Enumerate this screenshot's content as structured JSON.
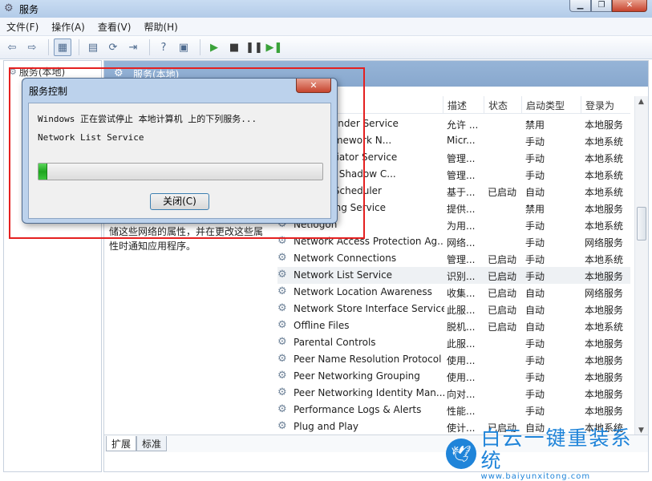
{
  "window": {
    "title": "服务",
    "min_label": "▁",
    "max_label": "❐",
    "close_label": "✕"
  },
  "menu": [
    "文件(F)",
    "操作(A)",
    "查看(V)",
    "帮助(H)"
  ],
  "toolbar": {
    "buttons": [
      "back-icon",
      "forward-icon",
      "show-tree-icon",
      "properties-icon",
      "refresh-icon",
      "export-icon",
      "help-icon",
      "console-icon",
      "play-icon",
      "stop-icon",
      "pause-icon",
      "restart-icon"
    ],
    "glyphs": {
      "back": "⇦",
      "forward": "⇨",
      "tree": "▦",
      "props": "▤",
      "refresh": "⟳",
      "export": "⇥",
      "help": "?",
      "console": "▣",
      "play": "▶",
      "stop": "■",
      "pause": "❚❚",
      "restart": "▶❚"
    }
  },
  "tree": {
    "label": "服务(本地)"
  },
  "content": {
    "header": "服务(本地)",
    "description_lines": [
      "储这些网络的属性，并在更改这些属",
      "性时通知应用程序。"
    ],
    "columns": {
      "description": "描述",
      "status": "状态",
      "startup": "启动类型",
      "logon": "登录为"
    },
    "tabs": [
      "扩展",
      "标准"
    ],
    "rows": [
      {
        "name": "nter Extender Service",
        "desc": "允许 ...",
        "status": "",
        "startup": "禁用",
        "logon": "本地服务"
      },
      {
        "name": ".NET Framework N...",
        "desc": "Micr...",
        "status": "",
        "startup": "手动",
        "logon": "本地系统"
      },
      {
        "name": "iSCSI Initiator Service",
        "desc": "管理...",
        "status": "",
        "startup": "手动",
        "logon": "本地系统"
      },
      {
        "name": "Software Shadow C...",
        "desc": "管理...",
        "status": "",
        "startup": "手动",
        "logon": "本地系统"
      },
      {
        "name": "ia Class Scheduler",
        "desc": "基于...",
        "status": "已启动",
        "startup": "自动",
        "logon": "本地系统"
      },
      {
        "name": "ort Sharing Service",
        "desc": "提供...",
        "status": "",
        "startup": "禁用",
        "logon": "本地服务"
      },
      {
        "name": "Netlogon",
        "desc": "为用...",
        "status": "",
        "startup": "手动",
        "logon": "本地系统"
      },
      {
        "name": "Network Access Protection Ag...",
        "desc": "网络...",
        "status": "",
        "startup": "手动",
        "logon": "网络服务"
      },
      {
        "name": "Network Connections",
        "desc": "管理...",
        "status": "已启动",
        "startup": "手动",
        "logon": "本地系统"
      },
      {
        "name": "Network List Service",
        "desc": "识别...",
        "status": "已启动",
        "startup": "手动",
        "logon": "本地服务",
        "selected": true
      },
      {
        "name": "Network Location Awareness",
        "desc": "收集...",
        "status": "已启动",
        "startup": "自动",
        "logon": "网络服务"
      },
      {
        "name": "Network Store Interface Service",
        "desc": "此服...",
        "status": "已启动",
        "startup": "自动",
        "logon": "本地服务"
      },
      {
        "name": "Offline Files",
        "desc": "脱机...",
        "status": "已启动",
        "startup": "自动",
        "logon": "本地系统"
      },
      {
        "name": "Parental Controls",
        "desc": "此服...",
        "status": "",
        "startup": "手动",
        "logon": "本地服务"
      },
      {
        "name": "Peer Name Resolution Protocol",
        "desc": "使用...",
        "status": "",
        "startup": "手动",
        "logon": "本地服务"
      },
      {
        "name": "Peer Networking Grouping",
        "desc": "使用...",
        "status": "",
        "startup": "手动",
        "logon": "本地服务"
      },
      {
        "name": "Peer Networking Identity Man...",
        "desc": "向对...",
        "status": "",
        "startup": "手动",
        "logon": "本地服务"
      },
      {
        "name": "Performance Logs & Alerts",
        "desc": "性能...",
        "status": "",
        "startup": "手动",
        "logon": "本地服务"
      },
      {
        "name": "Plug and Play",
        "desc": "使计...",
        "status": "已启动",
        "startup": "自动",
        "logon": "本地系统"
      }
    ]
  },
  "dialog": {
    "title": "服务控制",
    "close_glyph": "✕",
    "message": "Windows 正在尝试停止 本地计算机 上的下列服务...",
    "service": "Network List Service",
    "progress_fraction": 0.03,
    "progress_color": "#1ea51e",
    "button": "关闭(C)"
  },
  "watermark": {
    "name": "白云一键重装系统",
    "url": "www.baiyunxitong.com",
    "icon": "bird-icon",
    "color": "#1f84d9"
  },
  "highlight": {
    "color": "#e42020"
  }
}
